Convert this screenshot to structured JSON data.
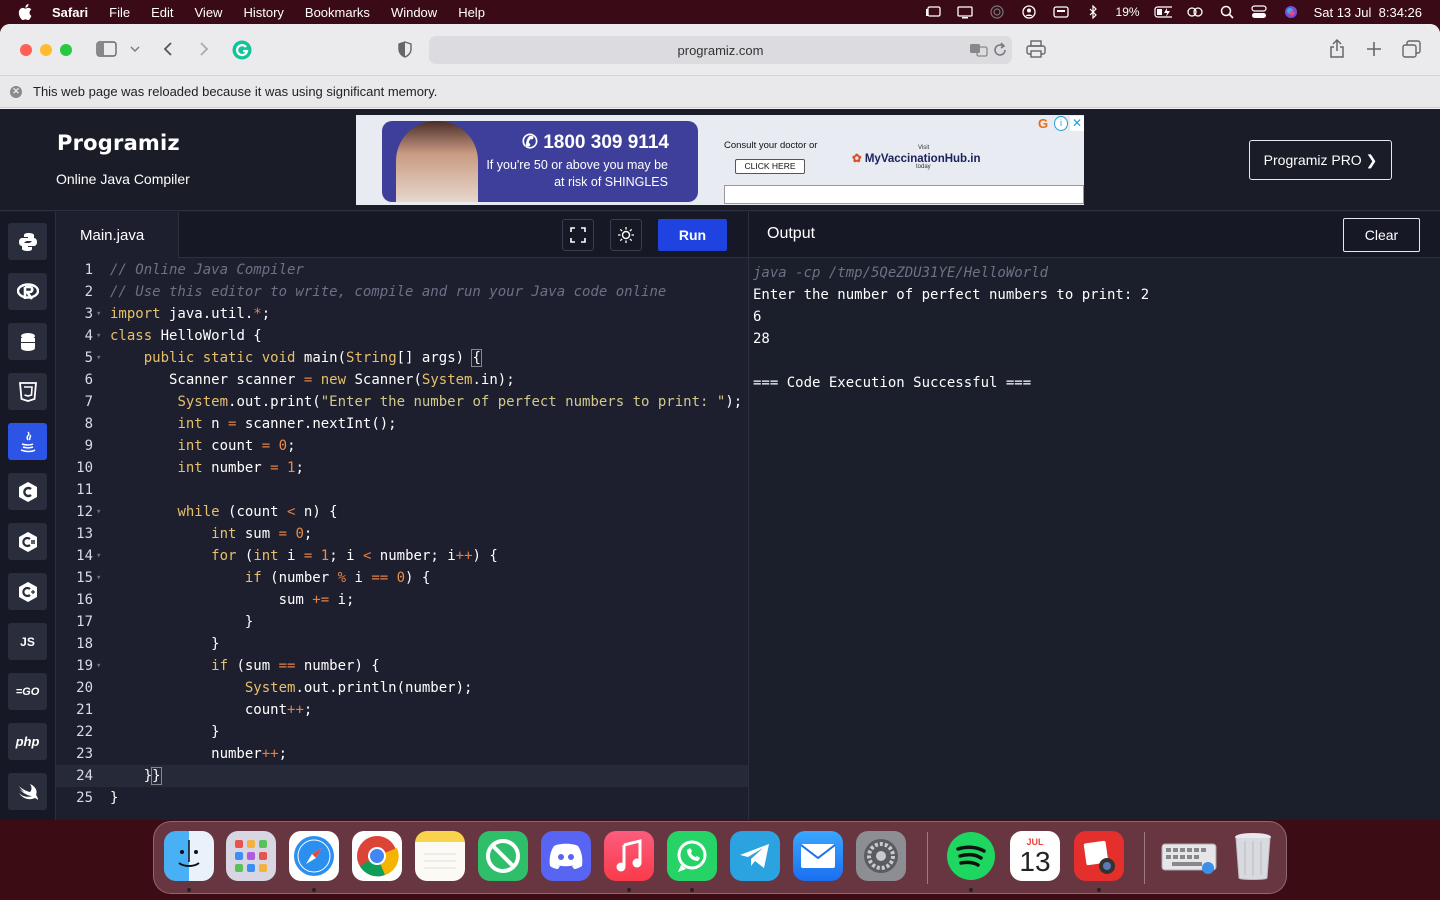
{
  "menubar": {
    "app": "Safari",
    "items": [
      "File",
      "Edit",
      "View",
      "History",
      "Bookmarks",
      "Window",
      "Help"
    ],
    "battery": "19%",
    "datetime": "Sat 13 Jul  8:34:26"
  },
  "browser": {
    "url": "programiz.com",
    "banner": "This web page was reloaded because it was using significant memory."
  },
  "site": {
    "logo": "Programiz",
    "subtitle": "Online Java Compiler",
    "pro_button": "Programiz PRO ❯",
    "ad": {
      "phone": "1800 309 9114",
      "line1": "If you're 50 or above you may be",
      "line2": "at risk of SHINGLES",
      "consult": "Consult your doctor or",
      "cta": "CLICK HERE",
      "visit": "Visit",
      "brand": "MyVaccinationHub.in",
      "today": "today"
    }
  },
  "editor": {
    "tab": "Main.java",
    "run_label": "Run",
    "lines": [
      "1",
      "2",
      "3",
      "4",
      "5",
      "6",
      "7",
      "8",
      "9",
      "10",
      "11",
      "12",
      "13",
      "14",
      "15",
      "16",
      "17",
      "18",
      "19",
      "20",
      "21",
      "22",
      "23",
      "24",
      "25"
    ]
  },
  "output": {
    "title": "Output",
    "clear_label": "Clear",
    "lines": [
      "java -cp /tmp/5QeZDU31YE/HelloWorld",
      "Enter the number of perfect numbers to print: 2",
      "6",
      "28",
      "",
      "=== Code Execution Successful ==="
    ]
  },
  "languages": [
    "python",
    "r",
    "sql",
    "html",
    "java",
    "c",
    "csharp",
    "cpp",
    "js",
    "go",
    "php",
    "swift"
  ],
  "lang_labels": {
    "js": "JS",
    "go": "GO",
    "php": "php"
  },
  "dock": {
    "apps": [
      "finder",
      "launchpad",
      "safari",
      "chrome",
      "notes",
      "app-blocker",
      "discord",
      "music",
      "whatsapp",
      "telegram",
      "mail",
      "system-settings",
      "spotify",
      "calendar",
      "photo-booth",
      "keyboard-viewer",
      "trash"
    ],
    "calendar_month": "JUL",
    "calendar_day": "13"
  },
  "colors": {
    "accent": "#1f43e0",
    "active_lang": "#2d55e5",
    "keyword": "#e6c06a",
    "comment": "#6d7185",
    "string": "#d2c98a",
    "number": "#ea8c4a"
  }
}
